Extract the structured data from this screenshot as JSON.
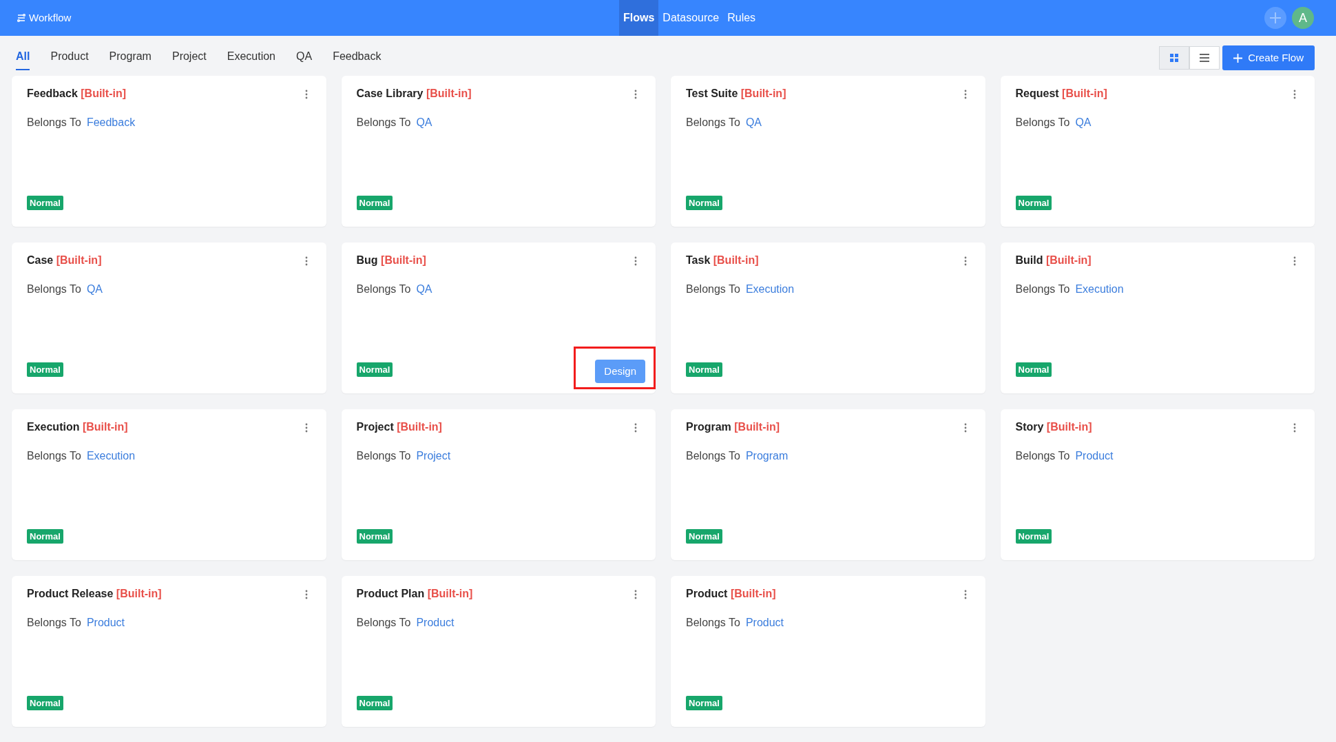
{
  "app": {
    "title": "Workflow",
    "nav": [
      {
        "label": "Flows",
        "selected": true
      },
      {
        "label": "Datasource",
        "selected": false
      },
      {
        "label": "Rules",
        "selected": false
      }
    ],
    "avatar": "A"
  },
  "tabs": [
    {
      "label": "All",
      "selected": true
    },
    {
      "label": "Product",
      "selected": false
    },
    {
      "label": "Program",
      "selected": false
    },
    {
      "label": "Project",
      "selected": false
    },
    {
      "label": "Execution",
      "selected": false
    },
    {
      "label": "QA",
      "selected": false
    },
    {
      "label": "Feedback",
      "selected": false
    }
  ],
  "view_toggle": [
    {
      "kind": "grid",
      "selected": true
    },
    {
      "kind": "list",
      "selected": false
    }
  ],
  "create_button": "Create Flow",
  "cards": [
    {
      "name": "Feedback",
      "tag": "[Built-in]",
      "belongs_label": "Belongs To",
      "belongs_to": "Feedback",
      "status": "Normal"
    },
    {
      "name": "Case Library",
      "tag": "[Built-in]",
      "belongs_label": "Belongs To",
      "belongs_to": "QA",
      "status": "Normal"
    },
    {
      "name": "Test Suite",
      "tag": "[Built-in]",
      "belongs_label": "Belongs To",
      "belongs_to": "QA",
      "status": "Normal"
    },
    {
      "name": "Request",
      "tag": "[Built-in]",
      "belongs_label": "Belongs To",
      "belongs_to": "QA",
      "status": "Normal"
    },
    {
      "name": "Case",
      "tag": "[Built-in]",
      "belongs_label": "Belongs To",
      "belongs_to": "QA",
      "status": "Normal"
    },
    {
      "name": "Bug",
      "tag": "[Built-in]",
      "belongs_label": "Belongs To",
      "belongs_to": "QA",
      "status": "Normal",
      "action": {
        "label": "Design",
        "highlighted": true
      }
    },
    {
      "name": "Task",
      "tag": "[Built-in]",
      "belongs_label": "Belongs To",
      "belongs_to": "Execution",
      "status": "Normal"
    },
    {
      "name": "Build",
      "tag": "[Built-in]",
      "belongs_label": "Belongs To",
      "belongs_to": "Execution",
      "status": "Normal"
    },
    {
      "name": "Execution",
      "tag": "[Built-in]",
      "belongs_label": "Belongs To",
      "belongs_to": "Execution",
      "status": "Normal"
    },
    {
      "name": "Project",
      "tag": "[Built-in]",
      "belongs_label": "Belongs To",
      "belongs_to": "Project",
      "status": "Normal"
    },
    {
      "name": "Program",
      "tag": "[Built-in]",
      "belongs_label": "Belongs To",
      "belongs_to": "Program",
      "status": "Normal"
    },
    {
      "name": "Story",
      "tag": "[Built-in]",
      "belongs_label": "Belongs To",
      "belongs_to": "Product",
      "status": "Normal"
    },
    {
      "name": "Product Release",
      "tag": "[Built-in]",
      "belongs_label": "Belongs To",
      "belongs_to": "Product",
      "status": "Normal"
    },
    {
      "name": "Product Plan",
      "tag": "[Built-in]",
      "belongs_label": "Belongs To",
      "belongs_to": "Product",
      "status": "Normal"
    },
    {
      "name": "Product",
      "tag": "[Built-in]",
      "belongs_label": "Belongs To",
      "belongs_to": "Product",
      "status": "Normal"
    }
  ]
}
